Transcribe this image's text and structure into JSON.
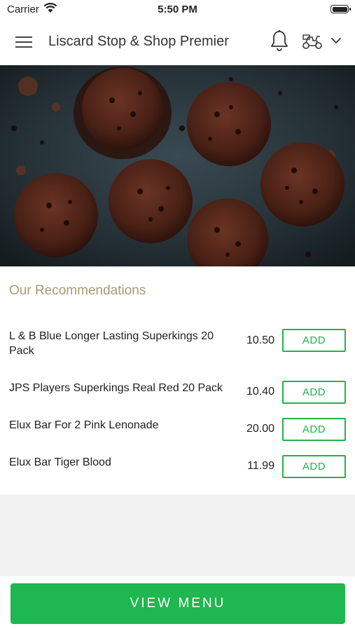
{
  "status_bar": {
    "carrier": "Carrier",
    "time": "5:50 PM"
  },
  "header": {
    "title": "Liscard Stop & Shop Premier",
    "icons": [
      "menu-icon",
      "bell-icon",
      "scooter-icon",
      "chevron-down-icon"
    ]
  },
  "hero": {
    "image": "chocolate-muffins-photo"
  },
  "recommendations": {
    "title": "Our Recommendations",
    "items": [
      {
        "name": "L & B Blue Longer Lasting Superkings 20 Pack",
        "price": "10.50",
        "button": "ADD"
      },
      {
        "name": "JPS Players Superkings Real Red 20 Pack",
        "price": "10.40",
        "button": "ADD"
      },
      {
        "name": "Elux Bar For 2 Pink Lenonade",
        "price": "20.00",
        "button": "ADD"
      },
      {
        "name": "Elux Bar Tiger Blood",
        "price": "11.99",
        "button": "ADD"
      }
    ]
  },
  "footer": {
    "view_menu": "VIEW MENU"
  },
  "colors": {
    "accent_green": "#1fb74f",
    "heading_gold": "#a79a73"
  }
}
